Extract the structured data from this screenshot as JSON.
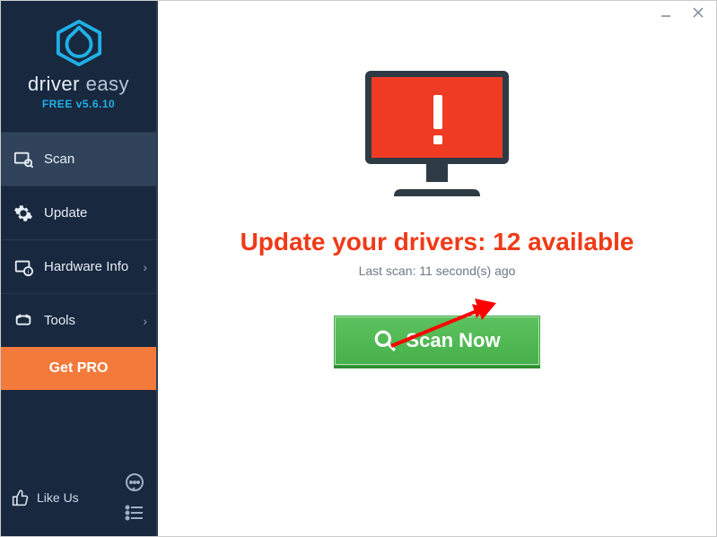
{
  "brand": {
    "name_1": "driver",
    "name_2": "easy",
    "version_line": "FREE v5.6.10"
  },
  "sidebar": {
    "items": [
      {
        "label": "Scan"
      },
      {
        "label": "Update"
      },
      {
        "label": "Hardware Info"
      },
      {
        "label": "Tools"
      }
    ],
    "getpro_label": "Get PRO",
    "likeus_label": "Like Us"
  },
  "main": {
    "headline": "Update your drivers: 12 available",
    "last_scan": "Last scan: 11 second(s) ago",
    "scan_button_label": "Scan Now"
  },
  "colors": {
    "accent_orange": "#f37a3b",
    "alert_red": "#f03a17",
    "scan_green": "#4fbd52",
    "sidebar_bg": "#18283f"
  }
}
